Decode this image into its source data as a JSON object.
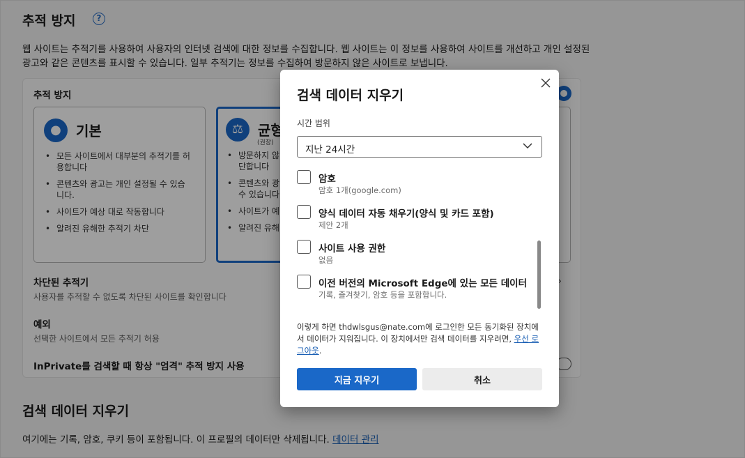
{
  "tracking": {
    "heading": "추적 방지",
    "help_icon_glyph": "?",
    "description": "웹 사이트는 추적기를 사용하여 사용자의 인터넷 검색에 대한 정보를 수집합니다. 웹 사이트는 이 정보를 사용하여 사이트를 개선하고 개인 설정된 광고와 같은 콘텐츠를 표시할 수 있습니다. 일부 추적기는 정보를 수집하여 방문하지 않은 사이트로 보냅니다.",
    "card_title": "추적 방지",
    "main_toggle_on": true,
    "options": {
      "basic": {
        "title": "기본",
        "icon": "users-icon",
        "bullets": [
          "모든 사이트에서 대부분의 추적기를 허용합니다",
          "콘텐츠와 광고는 개인 설정될 수 있습니다.",
          "사이트가 예상 대로 작동합니다",
          "알려진 유해한 추적기 차단"
        ]
      },
      "balanced": {
        "title": "균형",
        "subtitle": "(권장)",
        "icon": "scales-icon",
        "selected": true,
        "bullets": [
          "방문하지 않",
          "콘텐츠와 광",
          "사이트가 예",
          "알려진 유해"
        ],
        "bullet_continuations": [
          "단합니다",
          "수 있습니다"
        ]
      }
    },
    "blocked": {
      "title": "차단된 추적기",
      "subtitle": "사용자를 추적할 수 없도록 차단된 사이트를 확인합니다"
    },
    "exceptions": {
      "title": "예외",
      "subtitle": "선택한 사이트에서 모든 추적기 허용"
    },
    "inprivate": {
      "title": "InPrivate를 검색할 때 항상 \"엄격\" 추적 방지 사용",
      "toggle_on": false
    }
  },
  "clear_section": {
    "heading": "검색 데이터 지우기",
    "description": "여기에는 기록, 암호, 쿠키 등이 포함됩니다. 이 프로필의 데이터만 삭제됩니다.",
    "link": "데이터 관리"
  },
  "dialog": {
    "title": "검색 데이터 지우기",
    "close_icon": "close-icon",
    "time_range_label": "시간 범위",
    "time_range_value": "지난 24시간",
    "items": [
      {
        "title": "암호",
        "sub": "암호 1개(google.com)",
        "checked": false
      },
      {
        "title": "양식 데이터 자동 채우기(양식 및 카드 포함)",
        "sub": "제안 2개",
        "checked": false
      },
      {
        "title": "사이트 사용 권한",
        "sub": "없음",
        "checked": false
      },
      {
        "title": "이전 버전의 Microsoft Edge에 있는 모든 데이터",
        "sub": "기록, 즐겨찾기, 암호 등을 포함합니다.",
        "checked": false
      }
    ],
    "note_text": "이렇게 하면 thdwlsgus@nate.com에 로그인한 모든 동기화된 장치에서 데이터가 지워집니다. 이 장치에서만 검색 데이터를 지우려면, ",
    "note_link": "우선 로그아웃",
    "note_end": ".",
    "primary_button": "지금 지우기",
    "secondary_button": "취소"
  },
  "colors": {
    "accent": "#1a68c8",
    "overlay": "rgba(0,0,0,0.38)"
  }
}
